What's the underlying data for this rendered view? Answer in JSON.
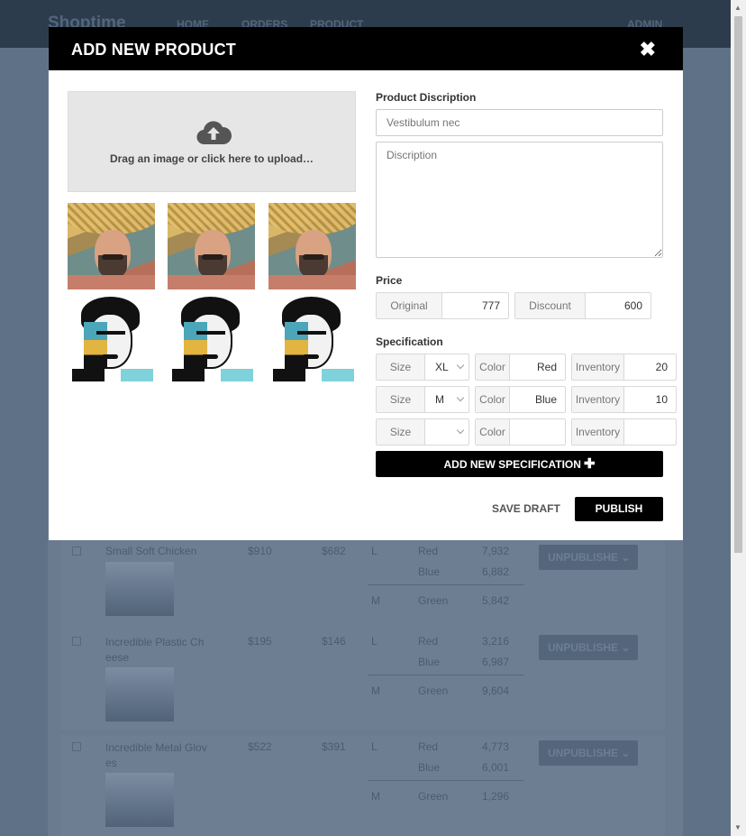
{
  "app": {
    "brand": "Shoptime",
    "nav": [
      "HOME",
      "ORDERS",
      "PRODUCT"
    ],
    "user": "ADMIN"
  },
  "modal": {
    "title": "ADD NEW PRODUCT",
    "close_icon": "close-icon",
    "upload_text": "Drag an image or click here to upload…",
    "upload_icon": "cloud-upload-icon",
    "thumbnails": [
      "straw-hat-portrait",
      "straw-hat-portrait",
      "straw-hat-portrait",
      "pop-art-portrait",
      "pop-art-portrait",
      "pop-art-portrait"
    ],
    "description_label": "Product Discription",
    "name_placeholder": "Vestibulum nec",
    "description_placeholder": "Discription",
    "price_label": "Price",
    "price": {
      "original_label": "Original",
      "original_value": "777",
      "discount_label": "Discount",
      "discount_value": "600"
    },
    "spec_label": "Specification",
    "specs": [
      {
        "size_label": "Size",
        "size": "XL",
        "color_label": "Color",
        "color": "Red",
        "inventory_label": "Inventory",
        "inventory": "20"
      },
      {
        "size_label": "Size",
        "size": "M",
        "color_label": "Color",
        "color": "Blue",
        "inventory_label": "Inventory",
        "inventory": "10"
      },
      {
        "size_label": "Size",
        "size": "",
        "color_label": "Color",
        "color": "",
        "inventory_label": "Inventory",
        "inventory": ""
      }
    ],
    "add_spec_label": "ADD NEW SPECIFICATION",
    "save_draft_label": "SAVE DRAFT",
    "publish_label": "PUBLISH"
  },
  "background_table": {
    "rows": [
      {
        "name": "Small Soft Chicken",
        "price": "$910",
        "sale": "$682",
        "sizes": [
          {
            "size": "L",
            "items": [
              {
                "color": "Red",
                "qty": "7,932"
              },
              {
                "color": "Blue",
                "qty": "6,882"
              }
            ]
          },
          {
            "size": "M",
            "items": [
              {
                "color": "Green",
                "qty": "5,842"
              }
            ]
          }
        ],
        "action": "UNPUBLISHE"
      },
      {
        "name": "Incredible Plastic Ch eese",
        "price": "$195",
        "sale": "$146",
        "sizes": [
          {
            "size": "L",
            "items": [
              {
                "color": "Red",
                "qty": "3,216"
              },
              {
                "color": "Blue",
                "qty": "6,987"
              }
            ]
          },
          {
            "size": "M",
            "items": [
              {
                "color": "Green",
                "qty": "9,604"
              }
            ]
          }
        ],
        "action": "UNPUBLISHE"
      },
      {
        "name": "Incredible Metal Glov es",
        "price": "$522",
        "sale": "$391",
        "sizes": [
          {
            "size": "L",
            "items": [
              {
                "color": "Red",
                "qty": "4,773"
              },
              {
                "color": "Blue",
                "qty": "6,001"
              }
            ]
          },
          {
            "size": "M",
            "items": [
              {
                "color": "Green",
                "qty": "1,296"
              }
            ]
          }
        ],
        "action": "UNPUBLISHE"
      }
    ]
  }
}
